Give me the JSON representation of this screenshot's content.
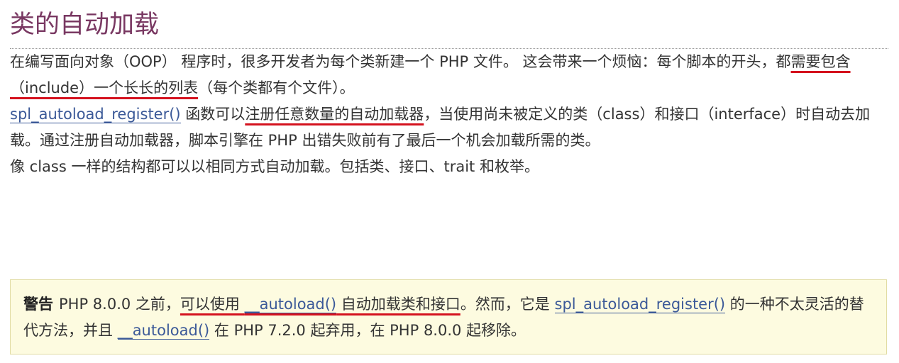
{
  "heading": "类的自动加载",
  "para1": {
    "t1": "在编写面向对象（OOP） 程序时，很多开发者为每个类新建一个 PHP 文件。 这会带来一个烦恼：每个脚本的开头，都",
    "t2_underlined": "需要包含（include）一个长长的列表",
    "t3": "（每个类都有个文件）。"
  },
  "para2": {
    "link1": "spl_autoload_register()",
    "t1": " 函数可以",
    "t2_underlined": "注册任意数量的自动加载器",
    "t3": "，当使用尚未被定义的类（class）和接口（interface）时自动去加载。通过注册自动加载器，脚本引擎在 PHP 出错失败前有了最后一个机会加载所需的类。"
  },
  "para3": "像 class 一样的结构都可以以相同方式自动加载。包括类、接口、trait 和枚举。",
  "warning": {
    "label": "警告",
    "t1": "PHP 8.0.0 之前，",
    "u1": "可以使用 ",
    "link_autoload": "__autoload()",
    "u2": " 自动加载类和接口",
    "t2": "。然而，它是 ",
    "link_spl": "spl_autoload_register()",
    "t3": " 的一种不太灵活的替代方法，并且 ",
    "link_autoload2": "__autoload()",
    "t4": " 在 PHP 7.2.0 起弃用，在 PHP 8.0.0 起移除。"
  },
  "colors": {
    "heading": "#793862",
    "link": "#3b5998",
    "underline_annotation": "#d4121e",
    "warning_bg": "#fdfbe0",
    "warning_border": "#e1dca4"
  }
}
